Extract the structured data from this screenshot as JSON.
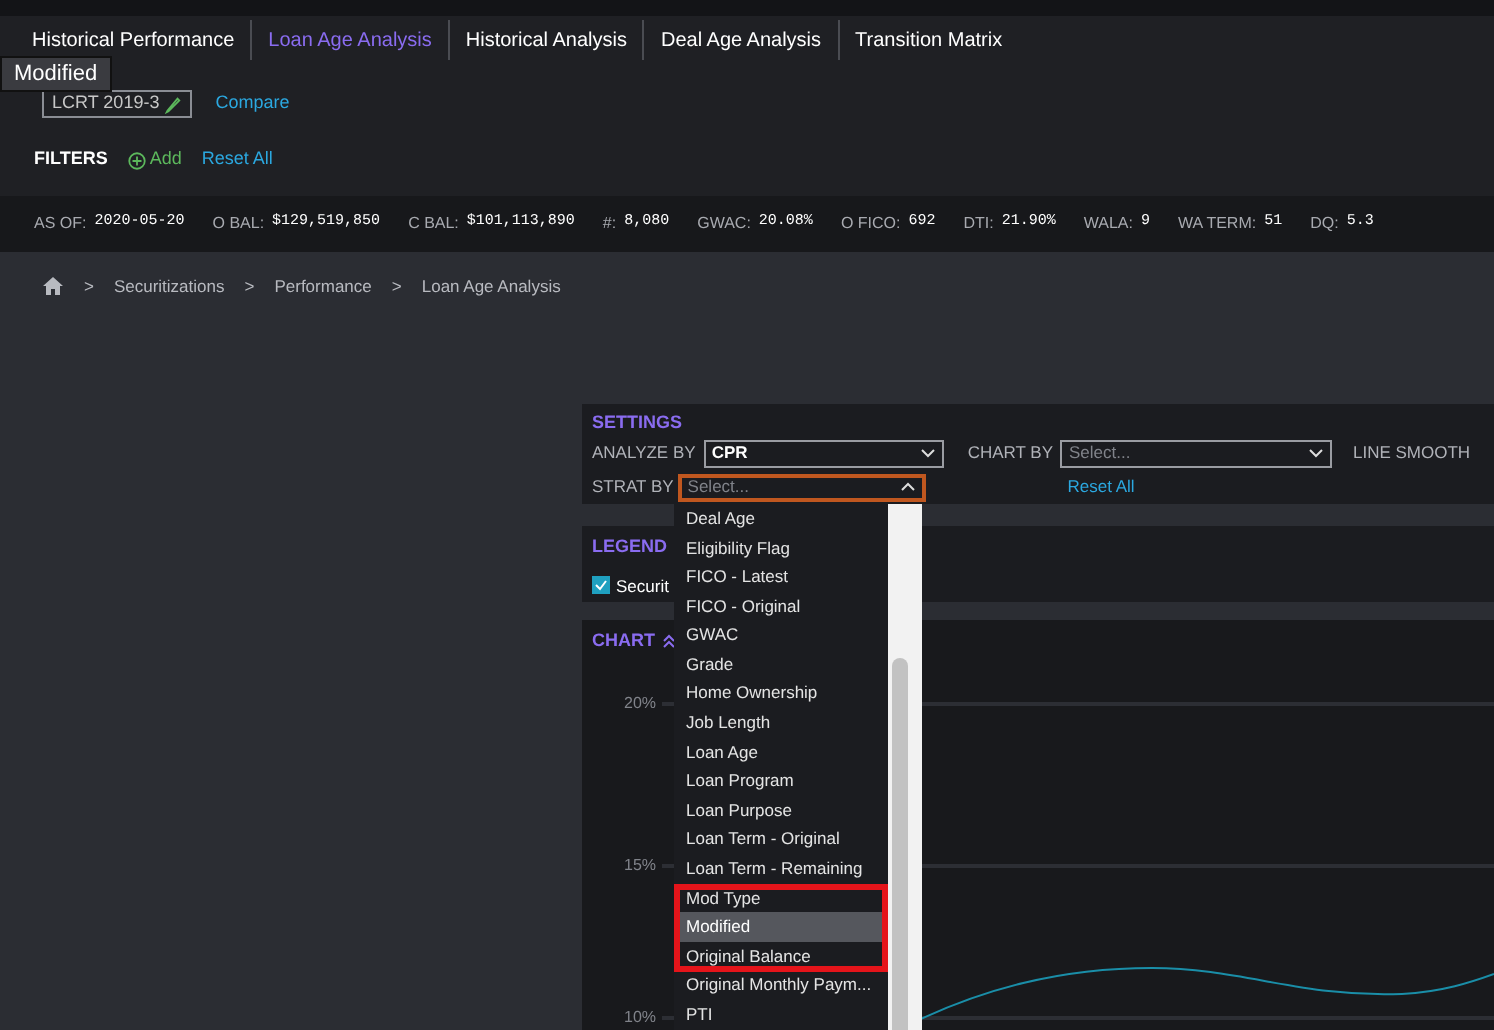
{
  "tabs": [
    {
      "label": "Historical Performance",
      "selected": false
    },
    {
      "label": "Loan Age Analysis",
      "selected": true
    },
    {
      "label": "Historical Analysis",
      "selected": false
    },
    {
      "label": "Deal Age Analysis",
      "selected": false
    },
    {
      "label": "Transition Matrix",
      "selected": false
    }
  ],
  "tooltip": "Modified",
  "deal": {
    "name": "LCRT 2019-3",
    "compare": "Compare"
  },
  "filters": {
    "label": "FILTERS",
    "add": "Add",
    "reset": "Reset All"
  },
  "stats": [
    {
      "label": "AS OF:",
      "value": "2020-05-20"
    },
    {
      "label": "O BAL:",
      "value": "$129,519,850"
    },
    {
      "label": "C BAL:",
      "value": "$101,113,890"
    },
    {
      "label": "#:",
      "value": "8,080"
    },
    {
      "label": "GWAC:",
      "value": "20.08%"
    },
    {
      "label": "O FICO:",
      "value": "692"
    },
    {
      "label": "DTI:",
      "value": "21.90%"
    },
    {
      "label": "WALA:",
      "value": "9"
    },
    {
      "label": "WA TERM:",
      "value": "51"
    },
    {
      "label": "DQ:",
      "value": "5.3"
    }
  ],
  "breadcrumb": [
    {
      "separator": ">",
      "label": "Securitizations"
    },
    {
      "separator": ">",
      "label": "Performance"
    },
    {
      "separator": ">",
      "label": "Loan Age Analysis"
    }
  ],
  "settings": {
    "title": "SETTINGS",
    "analyze_by": {
      "label": "ANALYZE BY",
      "value": "CPR"
    },
    "chart_by": {
      "label": "CHART BY",
      "placeholder": "Select..."
    },
    "line_smooth": {
      "label": "LINE SMOOTH"
    },
    "strat_by": {
      "label": "STRAT BY",
      "placeholder": "Select...",
      "expanded": true
    },
    "reset": "Reset All",
    "options": [
      {
        "label": "Deal Age",
        "selected": false,
        "highlighted": false
      },
      {
        "label": "Eligibility Flag",
        "selected": false,
        "highlighted": false
      },
      {
        "label": "FICO - Latest",
        "selected": false,
        "highlighted": false
      },
      {
        "label": "FICO - Original",
        "selected": false,
        "highlighted": false
      },
      {
        "label": "GWAC",
        "selected": false,
        "highlighted": false
      },
      {
        "label": "Grade",
        "selected": false,
        "highlighted": false
      },
      {
        "label": "Home Ownership",
        "selected": false,
        "highlighted": false
      },
      {
        "label": "Job Length",
        "selected": false,
        "highlighted": false
      },
      {
        "label": "Loan Age",
        "selected": false,
        "highlighted": false
      },
      {
        "label": "Loan Program",
        "selected": false,
        "highlighted": false
      },
      {
        "label": "Loan Purpose",
        "selected": false,
        "highlighted": false
      },
      {
        "label": "Loan Term - Original",
        "selected": false,
        "highlighted": false
      },
      {
        "label": "Loan Term - Remaining",
        "selected": false,
        "highlighted": false
      },
      {
        "label": "Mod Type",
        "selected": false,
        "highlighted": true
      },
      {
        "label": "Modified",
        "selected": true,
        "highlighted": true
      },
      {
        "label": "Original Balance",
        "selected": false,
        "highlighted": true
      },
      {
        "label": "Original Monthly Paym...",
        "selected": false,
        "highlighted": false
      },
      {
        "label": "PTI",
        "selected": false,
        "highlighted": false
      }
    ]
  },
  "legend": {
    "title": "LEGEND",
    "items": [
      {
        "label": "Securit",
        "checked": true
      }
    ]
  },
  "chart": {
    "title": "CHART",
    "y_ticks": [
      "20%",
      "15%",
      "10%"
    ]
  }
}
